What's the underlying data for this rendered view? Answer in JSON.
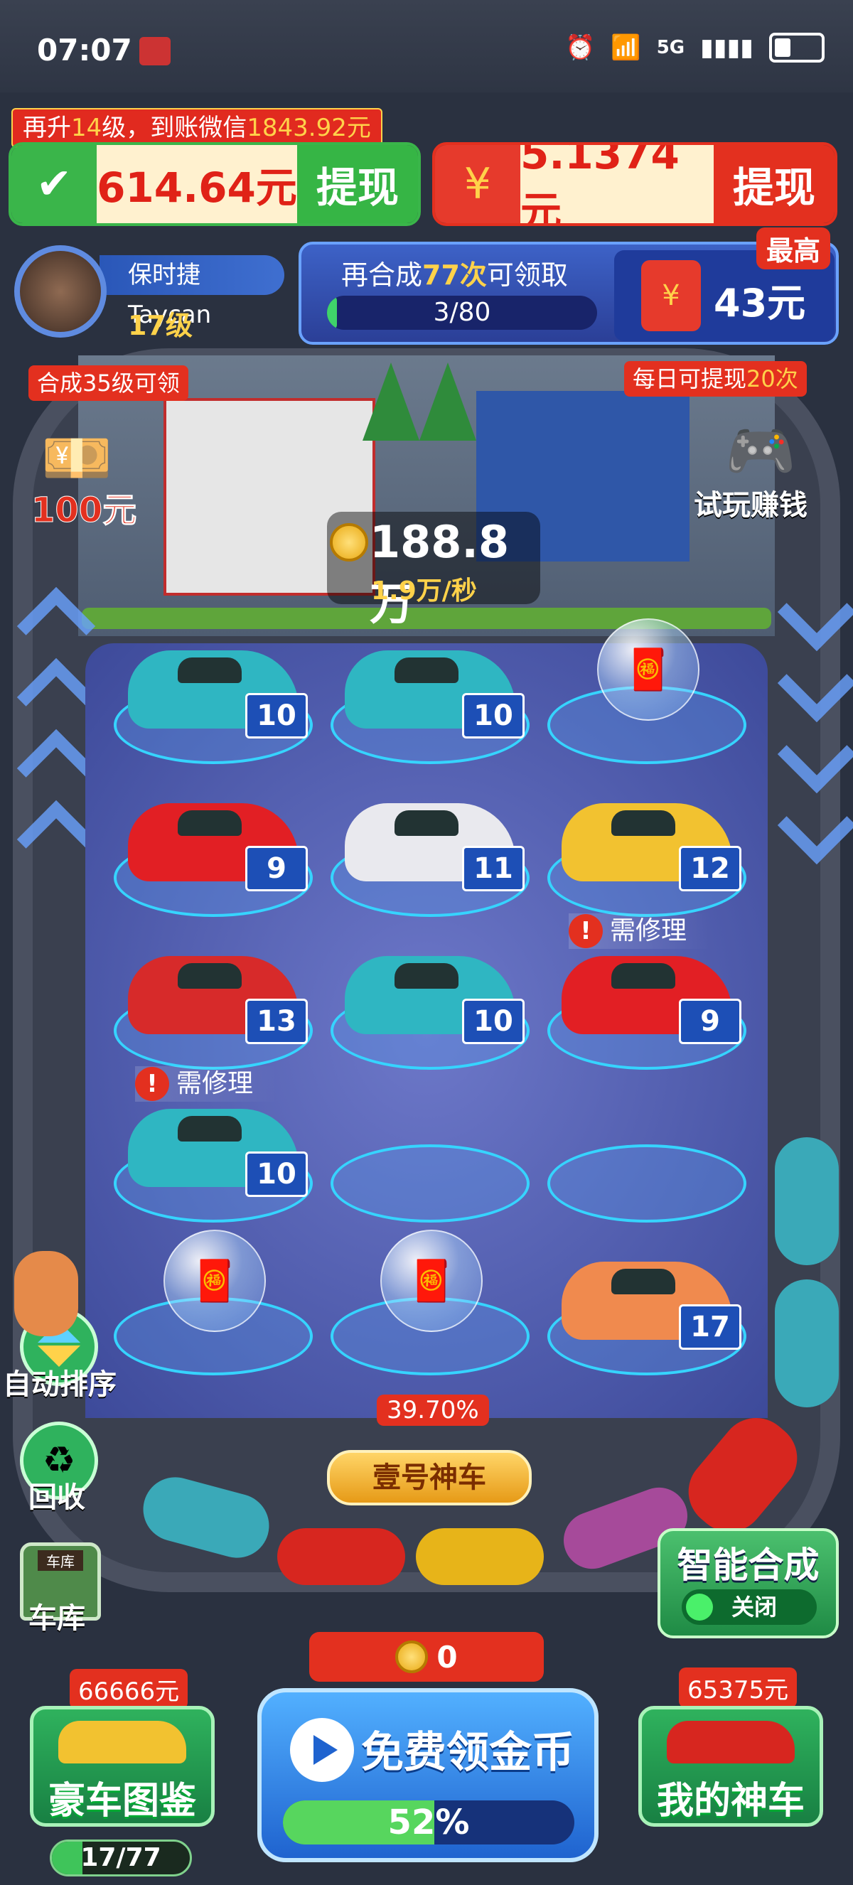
{
  "status_bar": {
    "time": "07:07",
    "network": "5G"
  },
  "banner": {
    "text_prefix": "再升",
    "levels": "14",
    "text_mid": "级，到账微信",
    "amount": "1843.92元"
  },
  "wallet_wechat": {
    "amount": "614.64元",
    "withdraw_label": "提现"
  },
  "wallet_red": {
    "amount": "5.1374元",
    "withdraw_label": "提现"
  },
  "player": {
    "car_name": "保时捷 Taycan",
    "level": "17级"
  },
  "merge_task": {
    "prefix": "再合成",
    "count": "77次",
    "suffix": "可领取",
    "progress_text": "3/80",
    "progress": 0.0375,
    "max_tag": "最高",
    "reward": "43元"
  },
  "left_reward": {
    "tag": "合成35级可领",
    "amount": "100元"
  },
  "right_reward": {
    "tag_prefix": "每日可提现",
    "tag_count": "20次",
    "label": "试玩赚钱"
  },
  "coins": {
    "total": "188.8万",
    "rate": "1.9万/秒"
  },
  "slots": [
    {
      "type": "car",
      "color": "#2fb6c2",
      "level": "10"
    },
    {
      "type": "car",
      "color": "#2fb6c2",
      "level": "10"
    },
    {
      "type": "bubble"
    },
    {
      "type": "car",
      "color": "#e21f24",
      "level": "9"
    },
    {
      "type": "car",
      "color": "#e9e9ee",
      "level": "11"
    },
    {
      "type": "car",
      "color": "#f2c230",
      "level": "12"
    },
    {
      "type": "car",
      "color": "#d72a2a",
      "level": "13"
    },
    {
      "type": "car",
      "color": "#2fb6c2",
      "level": "10"
    },
    {
      "type": "car",
      "color": "#e21f24",
      "level": "9",
      "repair": "需修理"
    },
    {
      "type": "car",
      "color": "#2fb6c2",
      "level": "10",
      "repair": "需修理"
    },
    {
      "type": "empty"
    },
    {
      "type": "empty"
    },
    {
      "type": "bubble"
    },
    {
      "type": "bubble"
    },
    {
      "type": "car",
      "color": "#f08a4e",
      "level": "17"
    }
  ],
  "side_buttons": {
    "auto_sort": "自动排序",
    "recycle": "回收",
    "garage": "车库",
    "garage_sign": "车库"
  },
  "legendary": {
    "chance": "39.70%",
    "label": "壹号神车"
  },
  "smart_merge": {
    "title": "智能合成",
    "toggle": "关闭"
  },
  "free_coins": {
    "coin_count": "0",
    "label": "免费领金币",
    "percent_text": "52%",
    "progress": 0.52
  },
  "luxury": {
    "price": "66666元",
    "label": "豪车图鉴",
    "collected": "17/77",
    "progress": 0.22
  },
  "my_car": {
    "price": "65375元",
    "label": "我的神车"
  },
  "colors": {
    "accent_red": "#e3301f",
    "gold": "#ffd24a",
    "green": "#3fc45a",
    "blue": "#1f63cf"
  }
}
